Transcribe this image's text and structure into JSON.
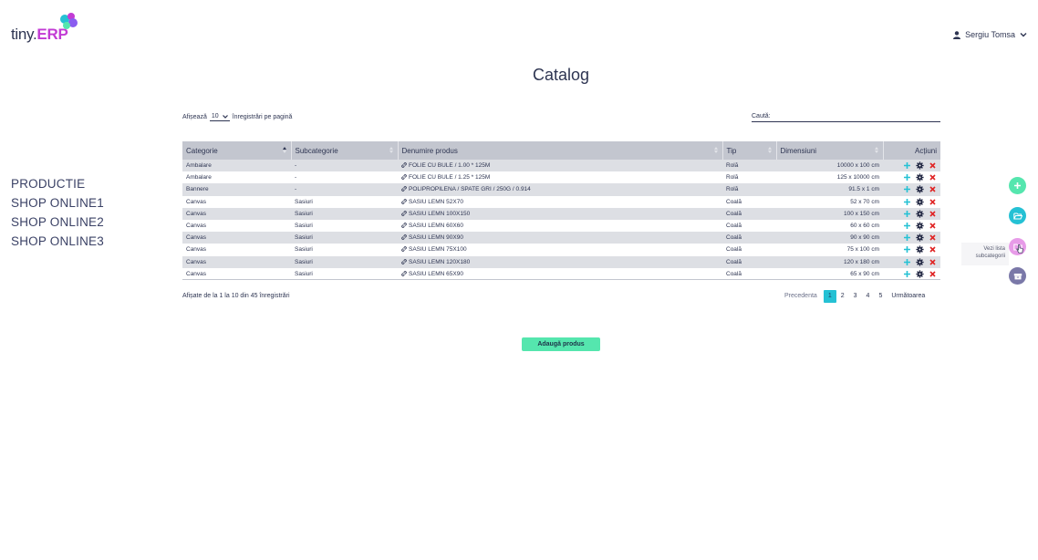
{
  "app": {
    "logo_prefix": "tiny.",
    "logo_suffix": "ERP"
  },
  "user": {
    "name": "Sergiu Tomsa"
  },
  "page": {
    "title": "Catalog"
  },
  "sidebar": {
    "items": [
      "PRODUCTIE",
      "SHOP ONLINE1",
      "SHOP ONLINE2",
      "SHOP ONLINE3"
    ]
  },
  "table_controls": {
    "length_prefix": "Afișează",
    "length_value": "10",
    "length_suffix": "înregistrări pe pagină",
    "search_label": "Caută:",
    "search_value": ""
  },
  "table": {
    "headers": [
      "Categorie",
      "Subcategorie",
      "Denumire produs",
      "Tip",
      "Dimensiuni",
      "Acțiuni"
    ],
    "rows": [
      {
        "categorie": "Ambalare",
        "subcategorie": "-",
        "denumire": "FOLIE CU BULE / 1.00 * 125M",
        "tip": "Rolă",
        "dimensiuni": "10000 x 100 cm"
      },
      {
        "categorie": "Ambalare",
        "subcategorie": "-",
        "denumire": "FOLIE CU BULE / 1.25 * 125M",
        "tip": "Rolă",
        "dimensiuni": "125 x 10000 cm"
      },
      {
        "categorie": "Bannere",
        "subcategorie": "-",
        "denumire": "POLIPROPILENA / SPATE GRI / 250G / 0.914",
        "tip": "Rolă",
        "dimensiuni": "91.5 x 1 cm"
      },
      {
        "categorie": "Canvas",
        "subcategorie": "Sasiuri",
        "denumire": "SASIU LEMN 52X70",
        "tip": "Coală",
        "dimensiuni": "52 x 70 cm"
      },
      {
        "categorie": "Canvas",
        "subcategorie": "Sasiuri",
        "denumire": "SASIU LEMN 100X150",
        "tip": "Coală",
        "dimensiuni": "100 x 150 cm"
      },
      {
        "categorie": "Canvas",
        "subcategorie": "Sasiuri",
        "denumire": "SASIU LEMN 60X60",
        "tip": "Coală",
        "dimensiuni": "60 x 60 cm"
      },
      {
        "categorie": "Canvas",
        "subcategorie": "Sasiuri",
        "denumire": "SASIU LEMN 90X90",
        "tip": "Coală",
        "dimensiuni": "90 x 90 cm"
      },
      {
        "categorie": "Canvas",
        "subcategorie": "Sasiuri",
        "denumire": "SASIU LEMN 75X100",
        "tip": "Coală",
        "dimensiuni": "75 x 100 cm"
      },
      {
        "categorie": "Canvas",
        "subcategorie": "Sasiuri",
        "denumire": "SASIU LEMN 120X180",
        "tip": "Coală",
        "dimensiuni": "120 x 180 cm"
      },
      {
        "categorie": "Canvas",
        "subcategorie": "Sasiuri",
        "denumire": "SASIU LEMN 65X90",
        "tip": "Coală",
        "dimensiuni": "65 x 90 cm"
      }
    ],
    "row_actions": [
      "plus-icon",
      "gear-icon",
      "close-icon"
    ]
  },
  "table_footer": {
    "info": "Afișate de la 1 la 10 din 45 înregistrări"
  },
  "pagination": {
    "prev": "Precedenta",
    "pages": [
      "1",
      "2",
      "3",
      "4",
      "5"
    ],
    "current": "1",
    "next": "Următoarea"
  },
  "add_button": {
    "label": "Adaugă produs"
  },
  "fab": {
    "tooltip_line1": "Vezi lista",
    "tooltip_line2": "subcategorii",
    "icons": [
      "plus-icon",
      "folder-open-icon",
      "folder-icon",
      "box-icon"
    ]
  },
  "colors": {
    "brand": "#c23bd4",
    "text": "#2e3552",
    "header_bg": "#c3c6cf",
    "row_alt": "#dddfe4",
    "green": "#55e6ae",
    "cyan": "#25c1d4",
    "pink": "#e79be8",
    "purple": "#7a78a8",
    "delete": "#e02424"
  }
}
